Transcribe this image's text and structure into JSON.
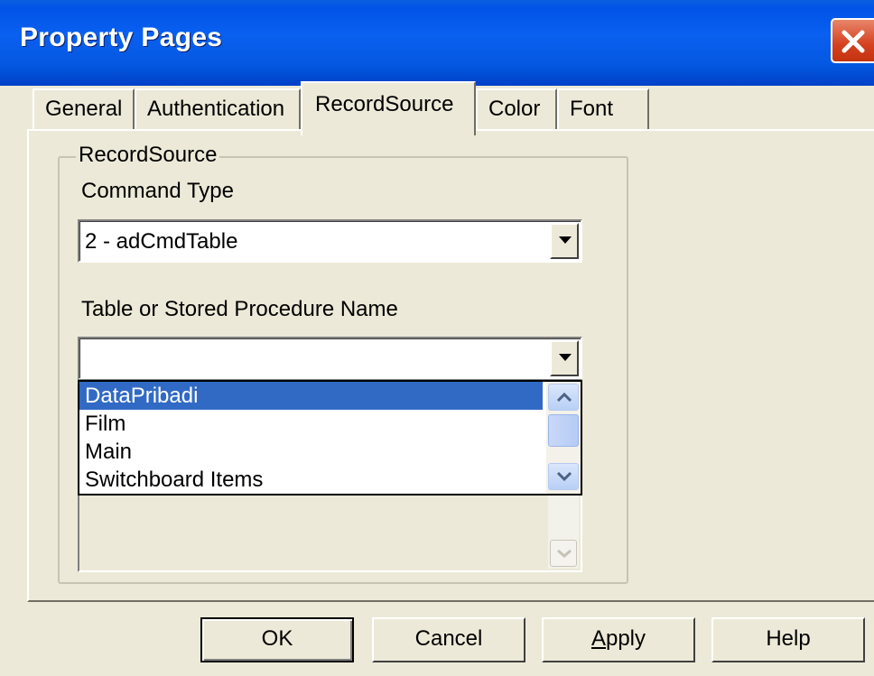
{
  "window": {
    "title": "Property Pages"
  },
  "tabs": [
    "General",
    "Authentication",
    "RecordSource",
    "Color",
    "Font"
  ],
  "selected_tab": "RecordSource",
  "group": {
    "label": "RecordSource",
    "command_type_label": "Command Type",
    "command_type_value": "2 - adCmdTable",
    "table_name_label": "Table or Stored Procedure Name",
    "table_name_value": ""
  },
  "dropdown": {
    "items": [
      "DataPribadi",
      "Film",
      "Main",
      "Switchboard Items"
    ],
    "highlighted": "DataPribadi"
  },
  "buttons": {
    "ok": "OK",
    "cancel": "Cancel",
    "apply_accel": "A",
    "apply_rest": "pply",
    "help": "Help"
  },
  "colors": {
    "titlebar": "#0055e5",
    "selection": "#316ac5",
    "face": "#ece9d8",
    "close": "#d4411f"
  }
}
